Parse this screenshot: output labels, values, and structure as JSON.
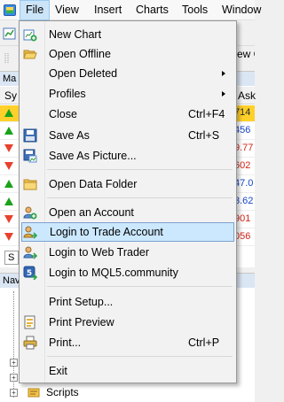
{
  "menubar": {
    "items": [
      {
        "label": "File",
        "active": true
      },
      {
        "label": "View",
        "active": false
      },
      {
        "label": "Insert",
        "active": false
      },
      {
        "label": "Charts",
        "active": false
      },
      {
        "label": "Tools",
        "active": false
      },
      {
        "label": "Window",
        "active": false
      }
    ]
  },
  "background": {
    "toolbar_fragment": "ew C",
    "market_watch": {
      "title_fragment": "Ma",
      "symbol_header": "Sy",
      "ask_header": "Ask",
      "rows": [
        {
          "dir": "up",
          "ask": "714",
          "color": "dark",
          "highlight": true
        },
        {
          "dir": "up",
          "ask": "456",
          "color": "blue",
          "highlight": false
        },
        {
          "dir": "down",
          "ask": "9.77",
          "color": "red",
          "highlight": false
        },
        {
          "dir": "down",
          "ask": "602",
          "color": "red",
          "highlight": false
        },
        {
          "dir": "up",
          "ask": "47.0",
          "color": "blue",
          "highlight": false
        },
        {
          "dir": "up",
          "ask": "3.62",
          "color": "blue",
          "highlight": false
        },
        {
          "dir": "down",
          "ask": "901",
          "color": "red",
          "highlight": false
        },
        {
          "dir": "down",
          "ask": "056",
          "color": "red",
          "highlight": false
        }
      ],
      "tab_fragment": "S"
    },
    "navigator": {
      "title_fragment": "Nav",
      "scripts_label": "Scripts"
    }
  },
  "file_menu": {
    "items": [
      {
        "label": "New Chart",
        "shortcut": "",
        "submenu": false,
        "icon": "new-chart-icon"
      },
      {
        "label": "Open Offline",
        "shortcut": "",
        "submenu": false,
        "icon": "open-folder-icon"
      },
      {
        "label": "Open Deleted",
        "shortcut": "",
        "submenu": true,
        "icon": ""
      },
      {
        "label": "Profiles",
        "shortcut": "",
        "submenu": true,
        "icon": ""
      },
      {
        "label": "Close",
        "shortcut": "Ctrl+F4",
        "submenu": false,
        "icon": ""
      },
      {
        "label": "Save As",
        "shortcut": "Ctrl+S",
        "submenu": false,
        "icon": "save-icon"
      },
      {
        "label": "Save As Picture...",
        "shortcut": "",
        "submenu": false,
        "icon": "save-picture-icon"
      },
      {
        "label": "Open Data Folder",
        "shortcut": "",
        "submenu": false,
        "icon": "folder-icon"
      },
      {
        "label": "Open an Account",
        "shortcut": "",
        "submenu": false,
        "icon": "open-account-icon"
      },
      {
        "label": "Login to Trade Account",
        "shortcut": "",
        "submenu": false,
        "icon": "login-trade-icon",
        "highlighted": true
      },
      {
        "label": "Login to Web Trader",
        "shortcut": "",
        "submenu": false,
        "icon": "web-trader-icon"
      },
      {
        "label": "Login to MQL5.community",
        "shortcut": "",
        "submenu": false,
        "icon": "mql5-icon"
      },
      {
        "label": "Print Setup...",
        "shortcut": "",
        "submenu": false,
        "icon": ""
      },
      {
        "label": "Print Preview",
        "shortcut": "",
        "submenu": false,
        "icon": "print-preview-icon"
      },
      {
        "label": "Print...",
        "shortcut": "Ctrl+P",
        "submenu": false,
        "icon": "print-icon"
      },
      {
        "label": "Exit",
        "shortcut": "",
        "submenu": false,
        "icon": ""
      }
    ]
  }
}
